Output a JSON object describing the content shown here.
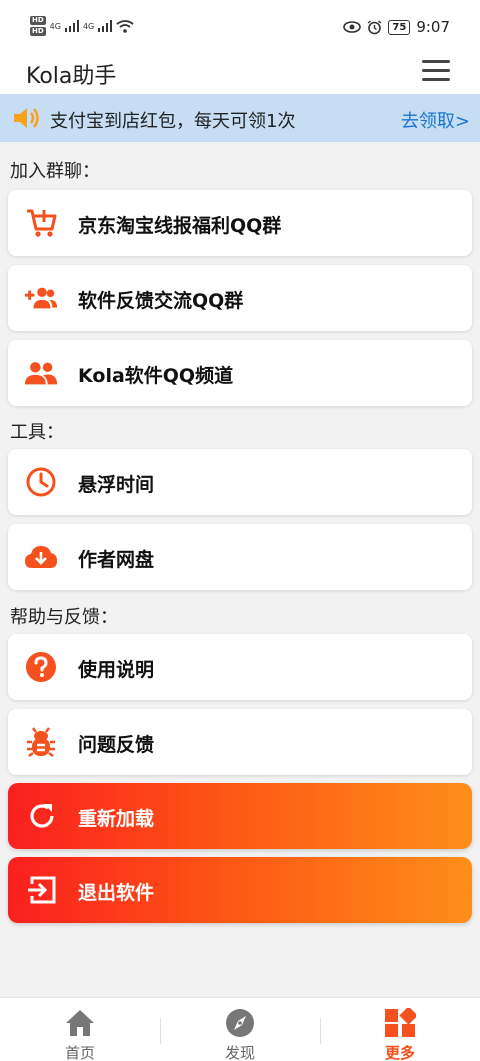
{
  "status_bar": {
    "hd1": "HD",
    "hd2": "HD",
    "net1": "4G",
    "net2": "4G",
    "battery": "75",
    "time": "9:07"
  },
  "header": {
    "title": "Kola助手"
  },
  "promo": {
    "text": "支付宝到店红包，每天可领1次",
    "link": "去领取>"
  },
  "sections": {
    "group": "加入群聊：",
    "tools": "工具：",
    "help": "帮助与反馈："
  },
  "cards": {
    "jd_group": "京东淘宝线报福利QQ群",
    "feedback_group": "软件反馈交流QQ群",
    "channel": "Kola软件QQ频道",
    "float_time": "悬浮时间",
    "cloud_disk": "作者网盘",
    "manual": "使用说明",
    "bug_report": "问题反馈"
  },
  "actions": {
    "reload": "重新加载",
    "exit": "退出软件"
  },
  "nav": {
    "home": "首页",
    "discover": "发现",
    "more": "更多"
  },
  "colors": {
    "accent": "#f4511e",
    "link": "#1976d2",
    "banner_bg": "#c6ddf3",
    "gradient_start": "#fa1f1f",
    "gradient_end": "#fe8e1a"
  }
}
